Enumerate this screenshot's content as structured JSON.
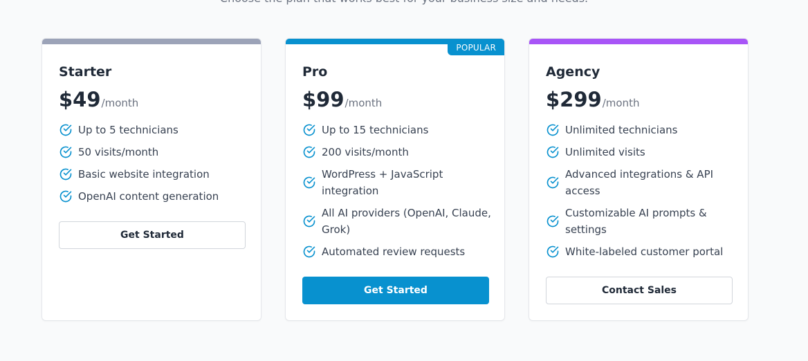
{
  "subtitle": "Choose the plan that works best for your business size and needs.",
  "colors": {
    "starter_accent": "#9ca3b8",
    "pro_accent": "#0891cf",
    "agency_accent": "#a855f7",
    "check_icon": "#0891cf"
  },
  "plans": [
    {
      "name": "Starter",
      "price": "$49",
      "period": "/month",
      "features": [
        "Up to 5 technicians",
        "50 visits/month",
        "Basic website integration",
        "OpenAI content generation"
      ],
      "button": "Get Started",
      "icon": "check-circle-icon"
    },
    {
      "name": "Pro",
      "badge": "POPULAR",
      "price": "$99",
      "period": "/month",
      "features": [
        "Up to 15 technicians",
        "200 visits/month",
        "WordPress + JavaScript integration",
        "All AI providers (OpenAI, Claude, Grok)",
        "Automated review requests"
      ],
      "button": "Get Started",
      "icon": "check-circle-icon"
    },
    {
      "name": "Agency",
      "price": "$299",
      "period": "/month",
      "features": [
        "Unlimited technicians",
        "Unlimited visits",
        "Advanced integrations & API access",
        "Customizable AI prompts & settings",
        "White-labeled customer portal"
      ],
      "button": "Contact Sales",
      "icon": "check-circle-icon"
    }
  ]
}
